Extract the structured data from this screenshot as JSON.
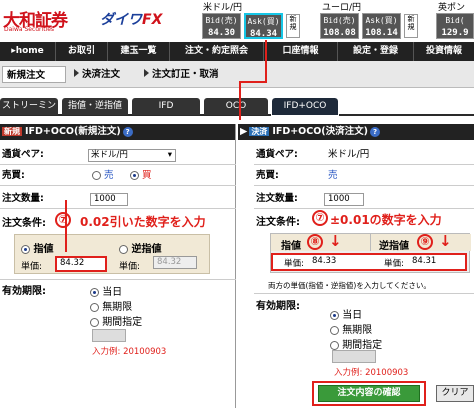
{
  "header": {
    "logo_main": "大和証券",
    "logo_sub": "Daiwa Securities",
    "logo_fx_a": "ダイワ",
    "logo_fx_b": "FX",
    "quotes": [
      {
        "pair": "米ドル/円",
        "bid_label": "Bid(売)",
        "bid": "84.30",
        "ask_label": "Ask(買)",
        "ask": "84.34"
      },
      {
        "pair": "ユーロ/円",
        "bid_label": "Bid(売)",
        "bid": "108.08",
        "ask_label": "Ask(買)",
        "ask": "108.14"
      },
      {
        "pair": "英ポン",
        "bid_label": "Bid(",
        "bid": "129.9"
      }
    ],
    "new_label": "新規"
  },
  "nav": {
    "items": [
      "home",
      "お取引",
      "建玉一覧",
      "注文・約定照会",
      "口座情報",
      "設定・登録",
      "投資情報"
    ]
  },
  "subnav": {
    "items": [
      "新規注文",
      "決済注文",
      "注文訂正・取消"
    ]
  },
  "tabs": [
    "ストリーミング",
    "指値・逆指値",
    "IFD",
    "OCO",
    "IFD+OCO"
  ],
  "left": {
    "tag": "新規",
    "title": "IFD+OCO(新規注文)",
    "pair_label": "通貨ペア:",
    "pair_value": "米ドル/円",
    "side_label": "売買:",
    "sell": "売",
    "buy": "買",
    "qty_label": "注文数量:",
    "qty_value": "1000",
    "cond_label": "注文条件:",
    "annotation_num": "⑦",
    "annotation_text": "0.02引いた数字を入力",
    "limit_label": "指値",
    "stop_label": "逆指値",
    "price_label": "単価:",
    "limit_price": "84.32",
    "stop_price": "84.32",
    "expiry_label": "有効期限:",
    "opt_today": "当日",
    "opt_none": "無期限",
    "opt_date": "期間指定",
    "example": "入力例: 20100903"
  },
  "right": {
    "tag": "決済",
    "title": "IFD+OCO(決済注文)",
    "pair_label": "通貨ペア:",
    "pair_value": "米ドル/円",
    "side_label": "売買:",
    "side_value": "売",
    "qty_label": "注文数量:",
    "qty_value": "1000",
    "cond_label": "注文条件:",
    "annotation_num": "⑦",
    "annotation_text": "±0.01の数字を入力",
    "limit_label": "指値",
    "limit_num": "⑧",
    "stop_label": "逆指値",
    "stop_num": "⑨",
    "price_label": "単価:",
    "limit_price": "84.33",
    "stop_price": "84.31",
    "note": "両方の単価(指値・逆指値)を入力してください。",
    "expiry_label": "有効期限:",
    "opt_today": "当日",
    "opt_none": "無期限",
    "opt_date": "期間指定",
    "example": "入力例: 20100903",
    "confirm_btn": "注文内容の確認",
    "clear_btn": "クリア"
  },
  "colors": {
    "accent_red": "#e0201b",
    "cyan_highlight": "#16c6e6",
    "nav_bg": "#222222"
  }
}
